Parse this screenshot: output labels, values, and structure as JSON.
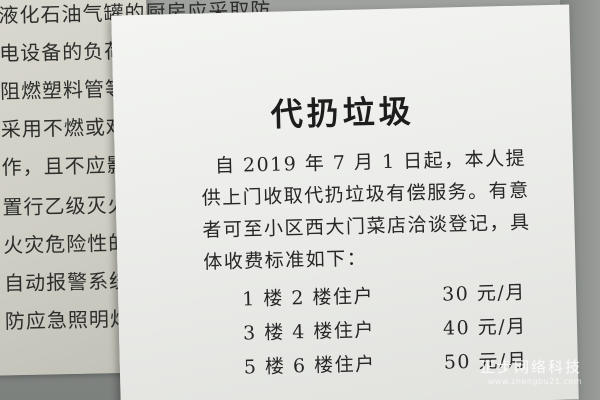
{
  "background_notice": {
    "lines": [
      "液化石油气罐的厨房应采取防",
      "电设备的负荷要",
      "阻燃塑料管等。",
      "采用不燃或难燃",
      "作，且不应影响",
      "置行乙级灭火救援",
      "火灾危险性的房",
      "自动报警系统或独",
      "防应急照明灯。"
    ]
  },
  "notice": {
    "title": "代扔垃圾",
    "body_lines": [
      "自 2019 年 7 月 1 日起，本人提",
      "供上门收取代扔垃圾有偿服务。有意",
      "者可至小区西大门菜店洽谈登记，具",
      "体收费标准如下："
    ],
    "fees": [
      {
        "label": "1 楼 2 楼住户",
        "price": "30 元/月"
      },
      {
        "label": "3 楼 4 楼住户",
        "price": "40 元/月"
      },
      {
        "label": "5 楼 6 楼住户",
        "price": "50 元/月"
      }
    ]
  },
  "watermark": {
    "name": "正步网络科技",
    "url": "www.zhengbu21.com"
  }
}
